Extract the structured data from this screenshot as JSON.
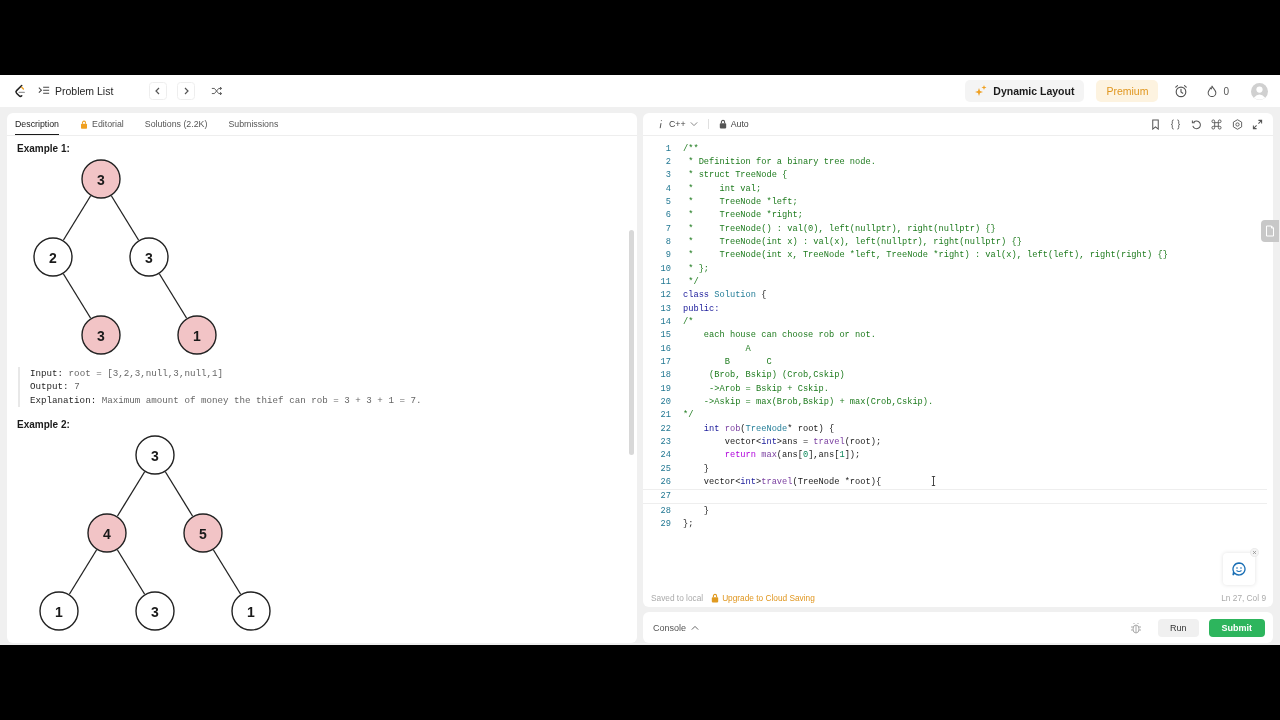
{
  "nav": {
    "problem_list": "Problem List",
    "dynamic_layout": "Dynamic Layout",
    "premium": "Premium",
    "streak": "0"
  },
  "description": {
    "tabs": [
      {
        "label": "Description",
        "selected": true,
        "locked": false
      },
      {
        "label": "Editorial",
        "selected": false,
        "locked": true
      },
      {
        "label": "Solutions (2.2K)",
        "selected": false,
        "locked": false
      },
      {
        "label": "Submissions",
        "selected": false,
        "locked": false
      }
    ],
    "examples": [
      {
        "title": "Example 1:",
        "tree": {
          "value": "3",
          "highlighted": true,
          "left": {
            "value": "2",
            "highlighted": false,
            "right": {
              "value": "3",
              "highlighted": true
            }
          },
          "right": {
            "value": "3",
            "highlighted": false,
            "right": {
              "value": "1",
              "highlighted": true
            }
          }
        },
        "io": [
          {
            "label": "Input:",
            "value": "root = [3,2,3,null,3,null,1]"
          },
          {
            "label": "Output:",
            "value": "7"
          },
          {
            "label": "Explanation:",
            "value": "Maximum amount of money the thief can rob = 3 + 3 + 1 = 7."
          }
        ]
      },
      {
        "title": "Example 2:",
        "tree": {
          "value": "3",
          "highlighted": false,
          "left": {
            "value": "4",
            "highlighted": true,
            "left": {
              "value": "1",
              "highlighted": false
            },
            "right": {
              "value": "3",
              "highlighted": false
            }
          },
          "right": {
            "value": "5",
            "highlighted": true,
            "right": {
              "value": "1",
              "highlighted": false
            }
          }
        }
      }
    ]
  },
  "editor": {
    "language": "C++",
    "mode": "Auto",
    "lines": [
      {
        "number": "1",
        "current": false,
        "segments": [
          {
            "kind": "comment",
            "text": "/**"
          }
        ]
      },
      {
        "number": "2",
        "current": false,
        "segments": [
          {
            "kind": "comment",
            "text": " * Definition for a binary tree node."
          }
        ]
      },
      {
        "number": "3",
        "current": false,
        "segments": [
          {
            "kind": "comment",
            "text": " * struct TreeNode {"
          }
        ]
      },
      {
        "number": "4",
        "current": false,
        "segments": [
          {
            "kind": "comment",
            "text": " *     int val;"
          }
        ]
      },
      {
        "number": "5",
        "current": false,
        "segments": [
          {
            "kind": "comment",
            "text": " *     TreeNode *left;"
          }
        ]
      },
      {
        "number": "6",
        "current": false,
        "segments": [
          {
            "kind": "comment",
            "text": " *     TreeNode *right;"
          }
        ]
      },
      {
        "number": "7",
        "current": false,
        "segments": [
          {
            "kind": "comment",
            "text": " *     TreeNode() : val(0), left(nullptr), right(nullptr) {}"
          }
        ]
      },
      {
        "number": "8",
        "current": false,
        "segments": [
          {
            "kind": "comment",
            "text": " *     TreeNode(int x) : val(x), left(nullptr), right(nullptr) {}"
          }
        ]
      },
      {
        "number": "9",
        "current": false,
        "segments": [
          {
            "kind": "comment",
            "text": " *     TreeNode(int x, TreeNode *left, TreeNode *right) : val(x), left(left), right(right) {}"
          }
        ]
      },
      {
        "number": "10",
        "current": false,
        "segments": [
          {
            "kind": "comment",
            "text": " * };"
          }
        ]
      },
      {
        "number": "11",
        "current": false,
        "segments": [
          {
            "kind": "comment",
            "text": " */"
          }
        ]
      },
      {
        "number": "12",
        "current": false,
        "segments": [
          {
            "kind": "keyword",
            "text": "class "
          },
          {
            "kind": "type",
            "text": "Solution"
          },
          {
            "kind": "plain",
            "text": " {"
          }
        ]
      },
      {
        "number": "13",
        "current": false,
        "segments": [
          {
            "kind": "keyword",
            "text": "public:"
          }
        ]
      },
      {
        "number": "14",
        "current": false,
        "segments": [
          {
            "kind": "comment",
            "text": "/*"
          }
        ]
      },
      {
        "number": "15",
        "current": false,
        "segments": [
          {
            "kind": "comment",
            "text": "    each house can choose rob or not."
          }
        ]
      },
      {
        "number": "16",
        "current": false,
        "segments": [
          {
            "kind": "comment",
            "text": "            A"
          }
        ]
      },
      {
        "number": "17",
        "current": false,
        "segments": [
          {
            "kind": "comment",
            "text": "        B       C"
          }
        ]
      },
      {
        "number": "18",
        "current": false,
        "segments": [
          {
            "kind": "comment",
            "text": "     (Brob, Bskip) (Crob,Cskip)"
          }
        ]
      },
      {
        "number": "19",
        "current": false,
        "segments": [
          {
            "kind": "comment",
            "text": "     ->Arob = Bskip + Cskip."
          }
        ]
      },
      {
        "number": "20",
        "current": false,
        "segments": [
          {
            "kind": "comment",
            "text": "    ->Askip = max(Brob,Bskip) + max(Crob,Cskip)."
          }
        ]
      },
      {
        "number": "21",
        "current": false,
        "segments": [
          {
            "kind": "comment",
            "text": "*/"
          }
        ]
      },
      {
        "number": "22",
        "current": false,
        "segments": [
          {
            "kind": "keyword",
            "text": "    int "
          },
          {
            "kind": "function",
            "text": "rob"
          },
          {
            "kind": "plain",
            "text": "("
          },
          {
            "kind": "type",
            "text": "TreeNode"
          },
          {
            "kind": "plain",
            "text": "* root) {"
          }
        ]
      },
      {
        "number": "23",
        "current": false,
        "segments": [
          {
            "kind": "plain",
            "text": "        vector<"
          },
          {
            "kind": "keyword",
            "text": "int"
          },
          {
            "kind": "plain",
            "text": ">ans = "
          },
          {
            "kind": "function",
            "text": "travel"
          },
          {
            "kind": "plain",
            "text": "(root);"
          }
        ]
      },
      {
        "number": "24",
        "current": false,
        "segments": [
          {
            "kind": "control",
            "text": "        return "
          },
          {
            "kind": "function",
            "text": "max"
          },
          {
            "kind": "plain",
            "text": "(ans["
          },
          {
            "kind": "number",
            "text": "0"
          },
          {
            "kind": "plain",
            "text": "],ans["
          },
          {
            "kind": "number",
            "text": "1"
          },
          {
            "kind": "plain",
            "text": "]);"
          }
        ]
      },
      {
        "number": "25",
        "current": false,
        "segments": [
          {
            "kind": "plain",
            "text": "    }"
          }
        ]
      },
      {
        "number": "26",
        "current": false,
        "segments": [
          {
            "kind": "plain",
            "text": "    vector<"
          },
          {
            "kind": "keyword",
            "text": "int"
          },
          {
            "kind": "plain",
            "text": ">"
          },
          {
            "kind": "function",
            "text": "travel"
          },
          {
            "kind": "plain",
            "text": "(TreeNode *root){"
          }
        ]
      },
      {
        "number": "27",
        "current": true
      },
      {
        "number": "28",
        "current": false,
        "segments": [
          {
            "kind": "plain",
            "text": "    }"
          }
        ]
      },
      {
        "number": "29",
        "current": false,
        "segments": [
          {
            "kind": "plain",
            "text": "};"
          }
        ]
      }
    ],
    "saved": "Saved to local",
    "upgrade": "Upgrade to Cloud Saving",
    "position": "Ln 27, Col 9"
  },
  "console": {
    "label": "Console",
    "run": "Run",
    "submit": "Submit"
  }
}
